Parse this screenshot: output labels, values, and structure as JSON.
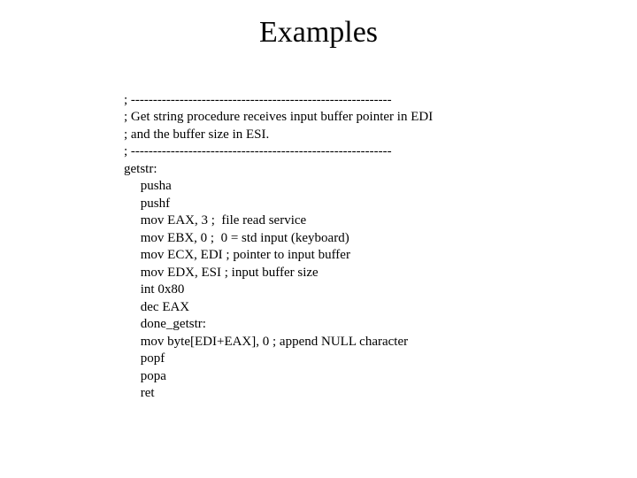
{
  "title": "Examples",
  "lines": {
    "l0": "; -----------------------------------------------------------",
    "l1": "; Get string procedure receives input buffer pointer in EDI",
    "l2": "; and the buffer size in ESI.",
    "l3": "; -----------------------------------------------------------",
    "l4": "getstr:",
    "l5": "     pusha",
    "l6": "     pushf",
    "l7": "     mov EAX, 3 ;  file read service",
    "l8": "     mov EBX, 0 ;  0 = std input (keyboard)",
    "l9": "     mov ECX, EDI ; pointer to input buffer",
    "l10": "     mov EDX, ESI ; input buffer size",
    "l11": "     int 0x80",
    "l12": "     dec EAX",
    "l13": "     done_getstr:",
    "l14": "     mov byte[EDI+EAX], 0 ; append NULL character",
    "l15": "     popf",
    "l16": "     popa",
    "l17": "     ret"
  }
}
